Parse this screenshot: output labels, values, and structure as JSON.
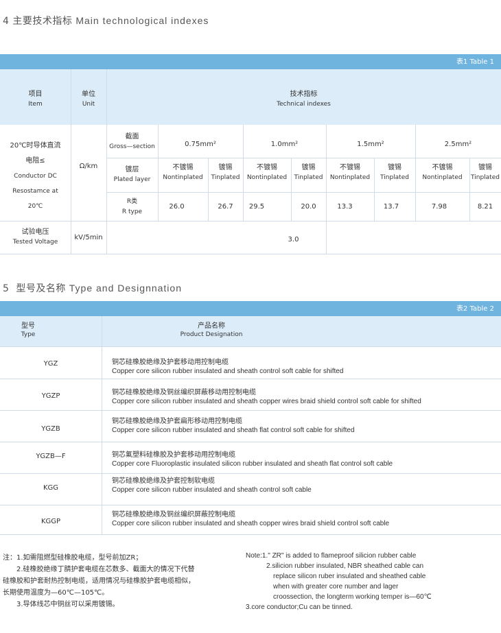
{
  "section4": {
    "number": "4",
    "title_cn": "主要技术指标",
    "title_en": "Main technological indexes"
  },
  "table1": {
    "caption": "表1  Table 1",
    "h_item_cn": "项目",
    "h_item_en": "Item",
    "h_unit_cn": "单位",
    "h_unit_en": "Unit",
    "h_tech_cn": "技术指标",
    "h_tech_en": "Technical indexes",
    "param1_lines": [
      "20℃时导体直流",
      "电阻≤",
      "Conductor DC",
      "Resostamce at",
      "20℃"
    ],
    "unit1": "Ω/km",
    "section_cn": "截面",
    "section_en": "Gross—section",
    "sizes": [
      "0.75mm²",
      "1.0mm²",
      "1.5mm²",
      "2.5mm²"
    ],
    "plated_cn": "镀层",
    "plated_en": "Plated layer",
    "non_cn": "不镀锡",
    "non_en": "Nontinplated",
    "tin_cn": "镀锡",
    "tin_en": "Tinplated",
    "rtype_cn": "R类",
    "rtype_en": "R type",
    "values": [
      "26.0",
      "26.7",
      "29.5",
      "20.0",
      "13.3",
      "13.7",
      "7.98",
      "8.21"
    ],
    "param2_cn": "试验电压",
    "param2_en": "Tested Voltage",
    "unit2": "kV/5min",
    "voltage": "3.0"
  },
  "section5": {
    "number": "5",
    "title_cn": "型号及名称",
    "title_en": "Type and Designnation"
  },
  "table2": {
    "caption": "表2  Table 2",
    "h_type_cn": "型号",
    "h_type_en": "Type",
    "h_name_cn": "产品名称",
    "h_name_en": "Product Designation",
    "rows": [
      {
        "type": "YGZ",
        "cn": "铜芯硅橡胶绝缘及护套移动用控制电缆",
        "en": "Copper core silicon rubber insulated and sheath control soft cable for shifted"
      },
      {
        "type": "YGZP",
        "cn": "铜芯硅橡胶绝缘及铜丝编织屏蔽移动用控制电缆",
        "en": "Copper core silicon rubber insulated and sheath copper wires braid shield control soft cable for shifted"
      },
      {
        "type": "YGZB",
        "cn": "铜芯硅橡胶绝缘及护套扁形移动用控制电缆",
        "en": "Copper core silicon rubber insulated and sheath flat control soft cable for shifted"
      },
      {
        "type": "YGZB—F",
        "cn": "铜芯氟塑料硅橡胶及护套移动用控制电缆",
        "en": "Copper core Fluoroplastic insulated silicon rubber insulated and sheath flat control soft cable"
      },
      {
        "type": "KGG",
        "cn": "铜芯硅橡胶绝缘及护套控制软电缆",
        "en": "Copper core silicon rubber insulated and sheath control soft cable"
      },
      {
        "type": "KGGP",
        "cn": "铜芯硅橡胶绝缘及铜丝编织屏蔽控制电缆",
        "en": "Copper core silicon rubber insulated and sheath copper wires braid shield control soft cable"
      }
    ]
  },
  "notes_cn": [
    "注：1.如需阻燃型硅橡胶电缆，型号前加ZR；",
    "　　2.硅橡胶绝缘丁腈护套电缆在芯数多、截面大的情况下代替",
    "硅橡胶和护套耐热控制电缆，适用情况与硅橡胶护套电缆相似，",
    "长期使用温度为—60℃—105℃。",
    "　　3.导体线芯中铜丝可以采用镀锡。"
  ],
  "notes_en": [
    "Note:1.\" ZR\" is added to flameproof silicion rubber cable",
    "2.silicion rubber insulated, NBR sheathed cable can",
    "replace silicon ruber insulated and sheathed cable",
    "when with greater core number and lager",
    "croossection, the longterm working temper is—60℃",
    "3.core conductor;Cu can be tinned."
  ]
}
